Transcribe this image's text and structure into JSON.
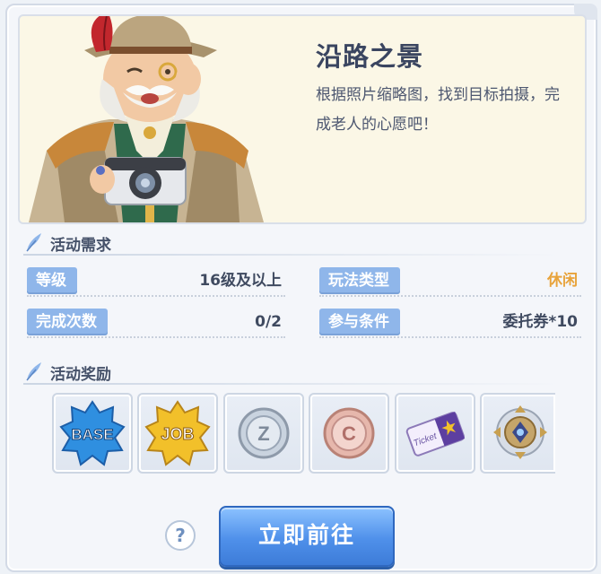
{
  "header": {
    "title": "沿路之景",
    "description": "根据照片缩略图，找到目标拍摄，完成老人的心愿吧！"
  },
  "requirements": {
    "section_title": "活动需求",
    "items": [
      {
        "label": "等级",
        "value": "16级及以上",
        "value_color": "#3f4a60"
      },
      {
        "label": "玩法类型",
        "value": "休闲",
        "value_color": "#e8a33a"
      },
      {
        "label": "完成次数",
        "value": "0/2",
        "value_color": "#3f4a60"
      },
      {
        "label": "参与条件",
        "value": "委托券*10",
        "value_color": "#3f4a60"
      }
    ]
  },
  "rewards": {
    "section_title": "活动奖励",
    "items": [
      {
        "icon": "base-exp-icon",
        "text": "BASE"
      },
      {
        "icon": "job-exp-icon",
        "text": "JOB"
      },
      {
        "icon": "zeny-coin-icon",
        "text": "Z"
      },
      {
        "icon": "contribution-coin-icon",
        "text": "C"
      },
      {
        "icon": "ticket-icon",
        "text": "Ticket"
      },
      {
        "icon": "emblem-icon",
        "text": ""
      }
    ]
  },
  "footer": {
    "help_label": "?",
    "go_label": "立即前往"
  },
  "colors": {
    "accent": "#4f90ea",
    "label_bg": "#8fb6ea",
    "highlight": "#e8a33a"
  }
}
